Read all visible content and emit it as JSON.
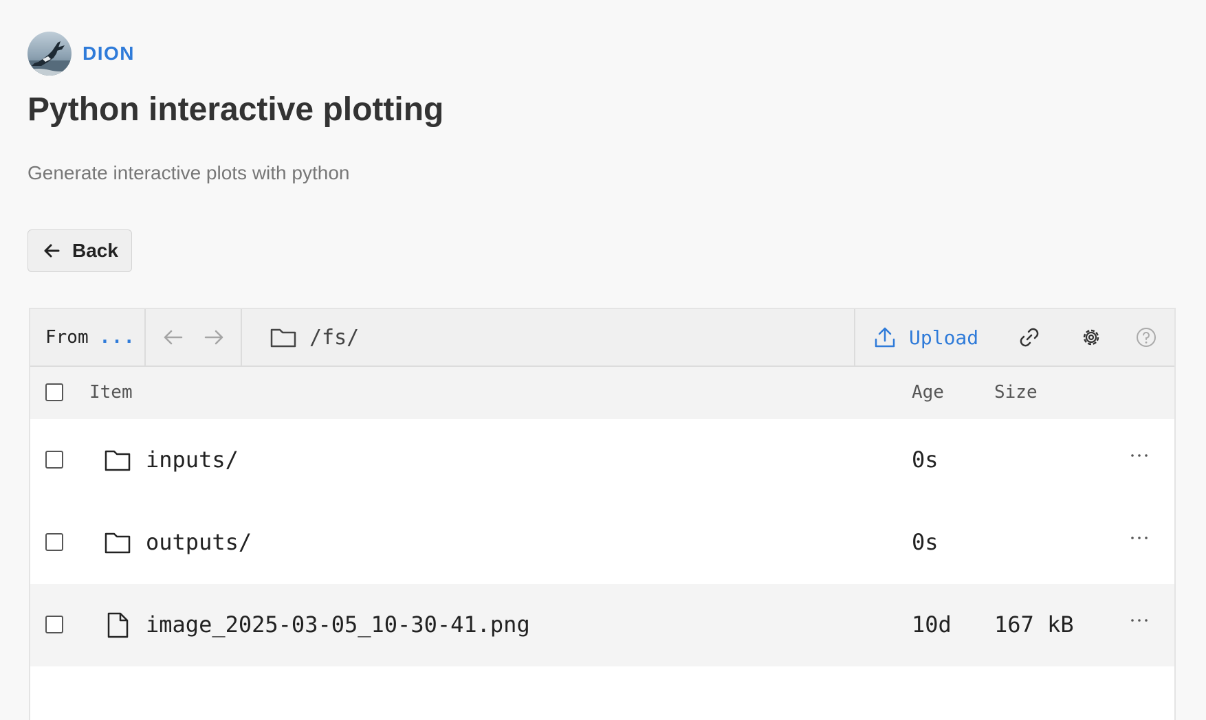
{
  "header": {
    "username": "DION"
  },
  "page": {
    "title": "Python interactive plotting",
    "subtitle": "Generate interactive plots with python",
    "back_label": "Back"
  },
  "browser": {
    "from_label": "From",
    "from_more": "...",
    "path": "/fs/",
    "upload_label": "Upload",
    "columns": {
      "item": "Item",
      "age": "Age",
      "size": "Size"
    },
    "rows": [
      {
        "name": "inputs/",
        "age": "0s",
        "size": "",
        "type": "folder"
      },
      {
        "name": "outputs/",
        "age": "0s",
        "size": "",
        "type": "folder"
      },
      {
        "name": "image_2025-03-05_10-30-41.png",
        "age": "10d",
        "size": "167 kB",
        "type": "file"
      }
    ]
  },
  "colors": {
    "accent": "#2f7bd9",
    "text": "#2f2f2f",
    "muted": "#777777",
    "background": "#f8f8f8"
  }
}
